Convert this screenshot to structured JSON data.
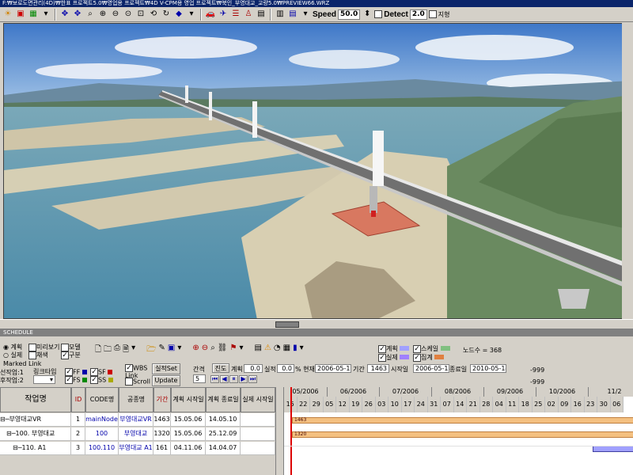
{
  "window": {
    "title": "F:₩보로도면관리(4D)₩한표 프로젝트5.0₩영업용 프로젝트₩4D V-CPM용 영업 프로젝트₩북인_부영대교_교량5.0₩PREVIEW66.WRZ"
  },
  "toolbar": {
    "speed_label": "Speed",
    "speed_value": "50.0",
    "detect_label": "Detect",
    "detect_value": "2.0",
    "terrain_label": "지형"
  },
  "panel": {
    "title": "SCHEDULE",
    "radio_plan": "계획",
    "radio_actual": "실제",
    "chk_preview": "미리보기",
    "chk_model": "모델",
    "chk_display": "채색",
    "chk_division": "구분",
    "marked_link": "Marked Link",
    "prev_job": "선작업:1",
    "next_job": "후작업:2",
    "link_type": "링크타입",
    "ff": "FF",
    "sf": "SF",
    "fs": "FS",
    "ss": "SS",
    "wbs_link": "WBS Link",
    "scroll": "Scroll",
    "btn_actual_set": "실적Set",
    "btn_update": "Update",
    "interval_label": "간격",
    "interval_value": "5",
    "progress_btn": "진도",
    "plan_label": "계획",
    "plan_value": "0.0",
    "actual_label": "실적",
    "actual_value": "0.0",
    "percent_label": "% 현재",
    "current_date": "2006-05-15",
    "period_label": "기간",
    "period_value": "1463",
    "start_label": "시작일",
    "start_date": "2006-05-15",
    "end_label": "종료일",
    "end_date": "2010-05-14",
    "legend_plan": "계획",
    "legend_actual": "실제",
    "legend_scale": "스케일",
    "legend_total": "집계",
    "node_count": "노드수 = 368",
    "right_val1": "-999",
    "right_val2": "-999"
  },
  "grid": {
    "headers": [
      "작업명",
      "ID",
      "CODE명",
      "공종명",
      "기간",
      "계획 시작일",
      "계획 종료일",
      "실제 시작일"
    ],
    "rows": [
      {
        "name": "부영대교VR",
        "id": "1",
        "code": "mainNode",
        "type": "부영대교VR",
        "dur": "1463",
        "start": "15.05.06",
        "end": "14.05.10",
        "actual": ""
      },
      {
        "name": "100. 부영대교",
        "id": "2",
        "code": "100",
        "type": "부영대교",
        "dur": "1320",
        "start": "15.05.06",
        "end": "25.12.09",
        "actual": ""
      },
      {
        "name": "110. A1",
        "id": "3",
        "code": "100.110",
        "type": "부영대교 A1",
        "dur": "161",
        "start": "04.11.06",
        "end": "14.04.07",
        "actual": ""
      }
    ]
  },
  "gantt": {
    "months": [
      "05/2006",
      "06/2006",
      "07/2006",
      "08/2006",
      "09/2006",
      "10/2006",
      "11/2"
    ],
    "days": [
      "15",
      "22",
      "29",
      "05",
      "12",
      "19",
      "26",
      "03",
      "10",
      "17",
      "24",
      "31",
      "07",
      "14",
      "21",
      "28",
      "04",
      "11",
      "18",
      "25",
      "02",
      "09",
      "16",
      "23",
      "30",
      "06"
    ],
    "bar1_label": "1463",
    "bar2_label": "1320"
  }
}
